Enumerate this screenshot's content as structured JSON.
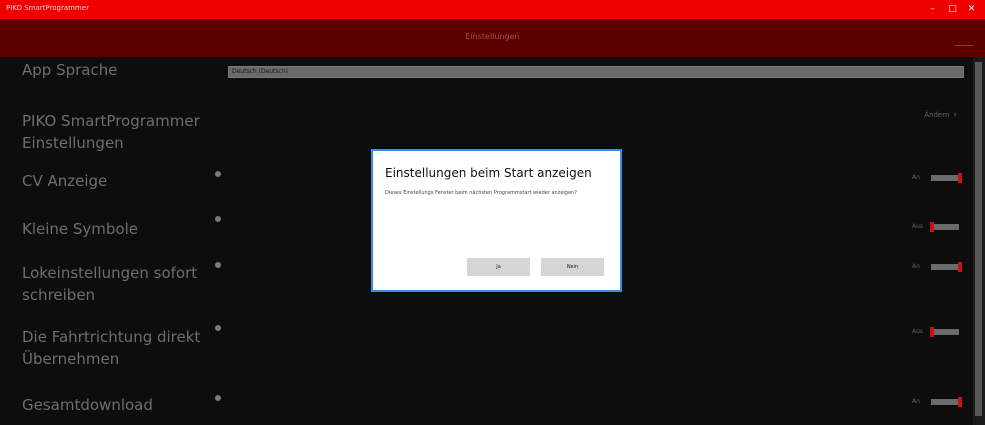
{
  "window": {
    "title": "PIKO SmartProgrammer",
    "minimize": "–",
    "maximize": "□",
    "close": "✕"
  },
  "header": {
    "title": "Einstellungen",
    "menu_icon": "hamburger-icon"
  },
  "settings": {
    "app_language": {
      "label": "App Sprache",
      "value": "Deutsch (Deutsch)"
    },
    "smart_settings": {
      "label_line1": "PIKO SmartProgrammer",
      "label_line2": "Einstellungen",
      "link_label": "Ändern",
      "link_arrow": "›"
    },
    "cv_display": {
      "label": "CV Anzeige",
      "state": "An",
      "on": true
    },
    "small_icons": {
      "label": "Kleine Symbole",
      "state": "Aus",
      "on": false
    },
    "loco_write": {
      "label_line1": "Lokeinstellungen sofort",
      "label_line2": "schreiben",
      "state": "An",
      "on": true
    },
    "direction": {
      "label_line1": "Die Fahrtrichtung direkt",
      "label_line2": "Übernehmen",
      "state": "Aus",
      "on": false
    },
    "full_download": {
      "label": "Gesamtdownload",
      "state": "An",
      "on": true
    }
  },
  "dialog": {
    "title": "Einstellungen beim Start anzeigen",
    "message": "Dieses Einstellungs Fenster beim nächsten Programmstart wieder anzeigen?",
    "yes_label": "Ja",
    "no_label": "Nein"
  },
  "colors": {
    "titlebar": "#ee0000",
    "subheader": "#5c0000",
    "background": "#0d0d0d",
    "toggle_accent": "#cc1111",
    "dialog_border": "#3d8be0"
  }
}
